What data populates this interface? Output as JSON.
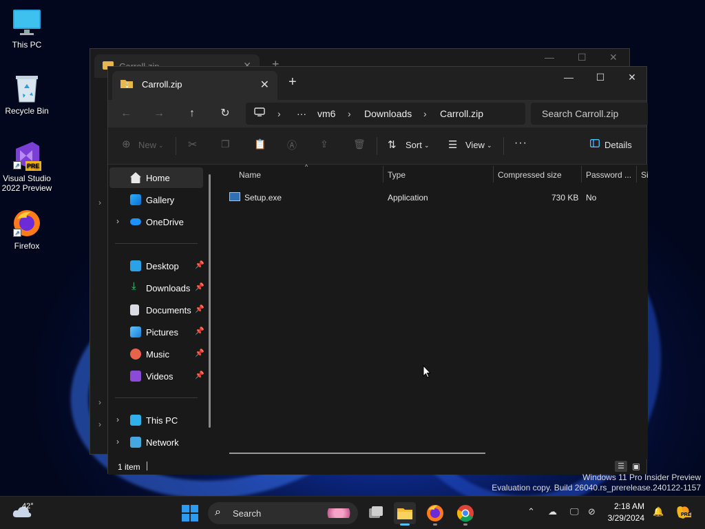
{
  "desktop": {
    "icons": [
      {
        "label": "This PC"
      },
      {
        "label": "Recycle Bin"
      },
      {
        "label": "Visual Studio 2022 Preview",
        "badge": "PRE"
      },
      {
        "label": "Firefox"
      }
    ]
  },
  "back_window": {
    "tab_title": "Carroll.zip"
  },
  "explorer": {
    "tab_title": "Carroll.zip",
    "new_tab_label": "+",
    "address": {
      "ellipsis": "···",
      "crumbs": [
        "vm6",
        "Downloads",
        "Carroll.zip"
      ]
    },
    "search_placeholder": "Search Carroll.zip",
    "commands": {
      "new": "New",
      "sort": "Sort",
      "view": "View",
      "more": "···",
      "details": "Details"
    },
    "nav": {
      "home": "Home",
      "gallery": "Gallery",
      "onedrive": "OneDrive",
      "desktop": "Desktop",
      "downloads": "Downloads",
      "documents": "Documents",
      "pictures": "Pictures",
      "music": "Music",
      "videos": "Videos",
      "this_pc": "This PC",
      "network": "Network"
    },
    "columns": [
      "Name",
      "Type",
      "Compressed size",
      "Password ...",
      "Si"
    ],
    "files": [
      {
        "name": "Setup.exe",
        "type": "Application",
        "compressed_size": "730 KB",
        "password": "No"
      }
    ],
    "status": "1 item"
  },
  "watermark": {
    "line1": "Windows 11 Pro Insider Preview",
    "line2": "Evaluation copy. Build 26040.rs_prerelease.240122-1157"
  },
  "taskbar": {
    "weather_temp": "42°",
    "search_label": "Search",
    "time": "2:18 AM",
    "date": "3/29/2024",
    "copilot_badge": "PRE"
  },
  "colors": {
    "accent": "#4cc2ff",
    "window_bg": "#191919",
    "taskbar_bg": "#1c1c1c"
  }
}
